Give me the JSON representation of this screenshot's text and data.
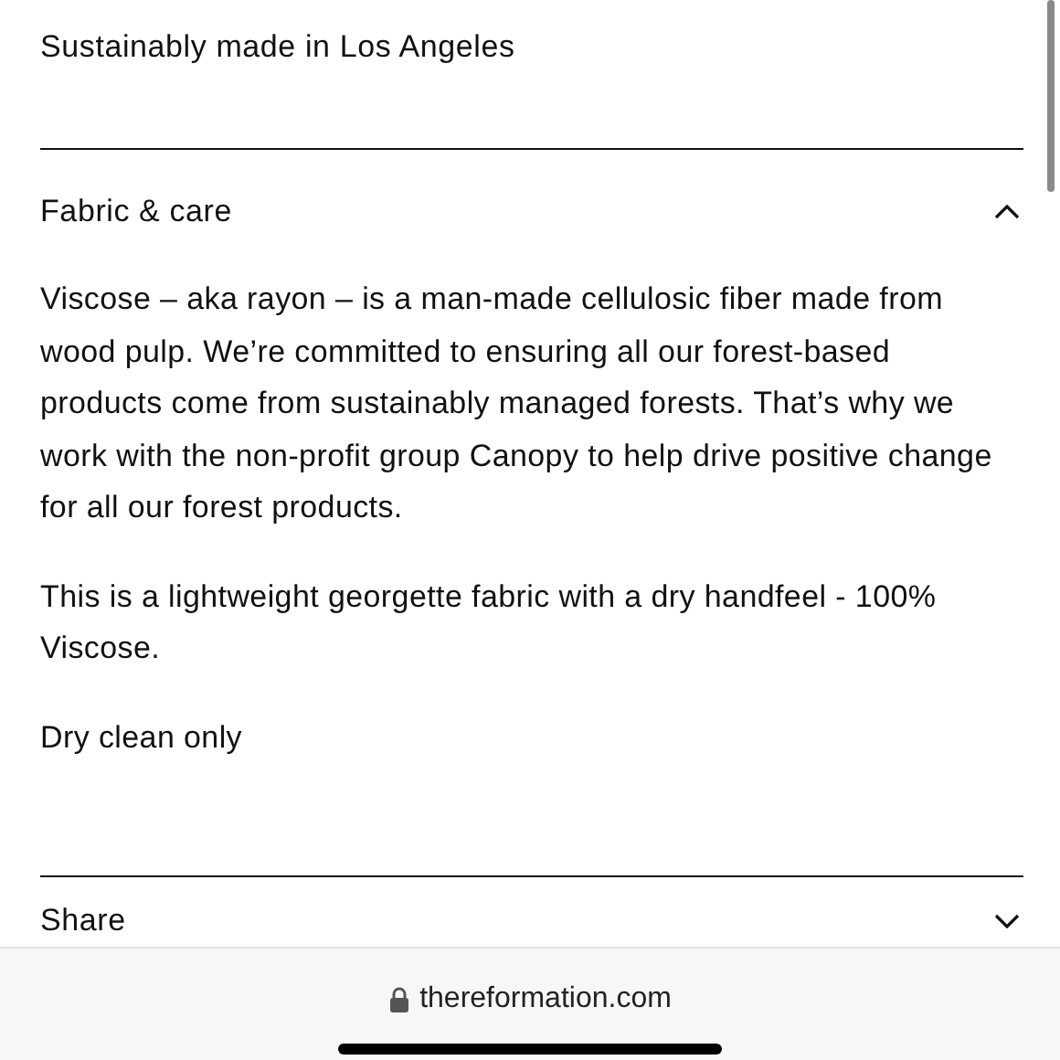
{
  "intro": "Sustainably made in Los Angeles",
  "accordion": [
    {
      "title": "Fabric & care",
      "expanded": true,
      "paragraphs": [
        "Viscose – aka rayon – is a man-made cellulosic fiber made from wood pulp. We’re committed to ensuring all our forest-based products come from sustainably managed forests. That’s why we work with the non-profit group Canopy to help drive positive change for all our forest products.",
        "This is a lightweight georgette fabric with a dry handfeel - 100% Viscose.",
        "Dry clean only"
      ]
    },
    {
      "title": "Share",
      "expanded": false
    }
  ],
  "browser_bar": {
    "url": "thereformation.com",
    "secure": true
  }
}
